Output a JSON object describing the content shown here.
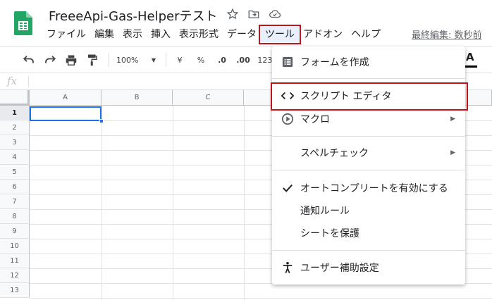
{
  "doc": {
    "title": "FreeeApi-Gas-Helperテスト",
    "last_edit": "最終編集: 数秒前"
  },
  "menu": {
    "items": [
      {
        "label": "ファイル"
      },
      {
        "label": "編集"
      },
      {
        "label": "表示"
      },
      {
        "label": "挿入"
      },
      {
        "label": "表示形式"
      },
      {
        "label": "データ"
      },
      {
        "label": "ツール"
      },
      {
        "label": "アドオン"
      },
      {
        "label": "ヘルプ"
      }
    ],
    "active": "ツール"
  },
  "toolbar": {
    "zoom": "100%",
    "currency": "¥",
    "percent": "%",
    "dec_decrease": ".0",
    "dec_increase": ".00",
    "format": "123"
  },
  "formula": {
    "fx": "fx"
  },
  "grid": {
    "columns": [
      "A",
      "B",
      "C"
    ],
    "rows": [
      "1",
      "2",
      "3",
      "4",
      "5",
      "6",
      "7",
      "8",
      "9",
      "10",
      "11",
      "12",
      "13"
    ]
  },
  "dropdown": {
    "items": [
      {
        "label": "フォームを作成",
        "icon": "form-icon"
      },
      {
        "label": "スクリプト エディタ",
        "icon": "code-icon"
      },
      {
        "label": "マクロ",
        "icon": "play-circle-icon",
        "submenu": true
      },
      {
        "label": "スペルチェック",
        "submenu": true
      },
      {
        "label": "オートコンプリートを有効にする",
        "icon": "check-icon"
      },
      {
        "label": "通知ルール"
      },
      {
        "label": "シートを保護"
      },
      {
        "label": "ユーザー補助設定",
        "icon": "accessibility-icon"
      }
    ]
  },
  "colors": {
    "accent": "#1a73e8",
    "highlight_red": "#c0141a",
    "sheets_green": "#23a566"
  }
}
